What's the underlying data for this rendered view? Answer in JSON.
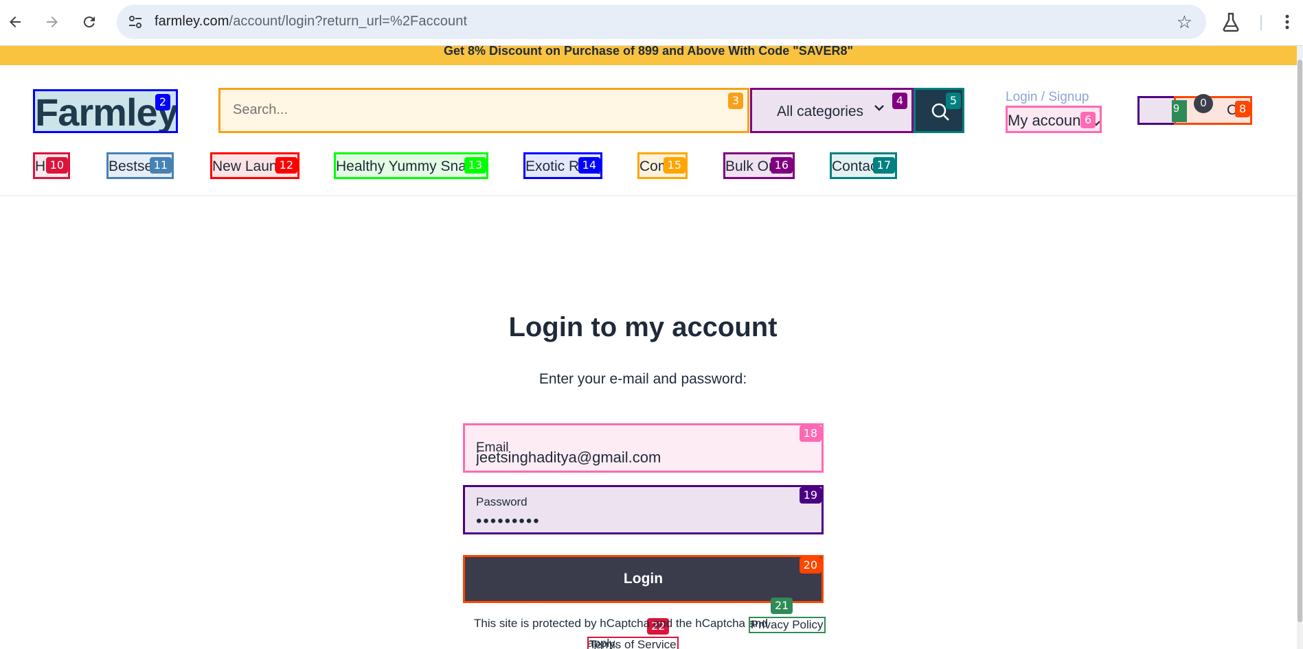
{
  "browser": {
    "url_host": "farmley.com",
    "url_path": "/account/login?return_url=%2Faccount"
  },
  "promo": {
    "text": "Get 8% Discount on Purchase of 899 and Above With Code \"SAVER8\""
  },
  "header": {
    "logo_text": "Farmley",
    "search_placeholder": "Search...",
    "category_label": "All categories",
    "login_signup": "Login / Signup",
    "my_account": "My account",
    "cart_label": "Cart",
    "cart_count": "0"
  },
  "nav": {
    "items": [
      "Home",
      "Bestsellers",
      "New Launches",
      "Healthy Yummy Snacks",
      "Exotic Range",
      "Combos",
      "Bulk Order",
      "Contact Us"
    ]
  },
  "login": {
    "title": "Login to my account",
    "subtitle": "Enter your e-mail and password:",
    "email_label": "Email",
    "email_value": "jeetsinghaditya@gmail.com",
    "password_label": "Password",
    "password_value": "•••••••••",
    "button": "Login",
    "captcha_prefix": "This site is protected by hCaptcha and the hCaptcha",
    "privacy_link": "Privacy Policy",
    "captcha_and": "and",
    "terms_link": "Terms of Service",
    "captcha_suffix": "apply."
  },
  "badges": [
    "2",
    "3",
    "4",
    "5",
    "6",
    "8",
    "9",
    "10",
    "11",
    "12",
    "13",
    "14",
    "15",
    "16",
    "17",
    "18",
    "19",
    "20",
    "21",
    "22"
  ],
  "colors": {
    "promo": "#f9c33f",
    "brand_dark": "#1f3a4d",
    "button": "#3a3b4b"
  }
}
